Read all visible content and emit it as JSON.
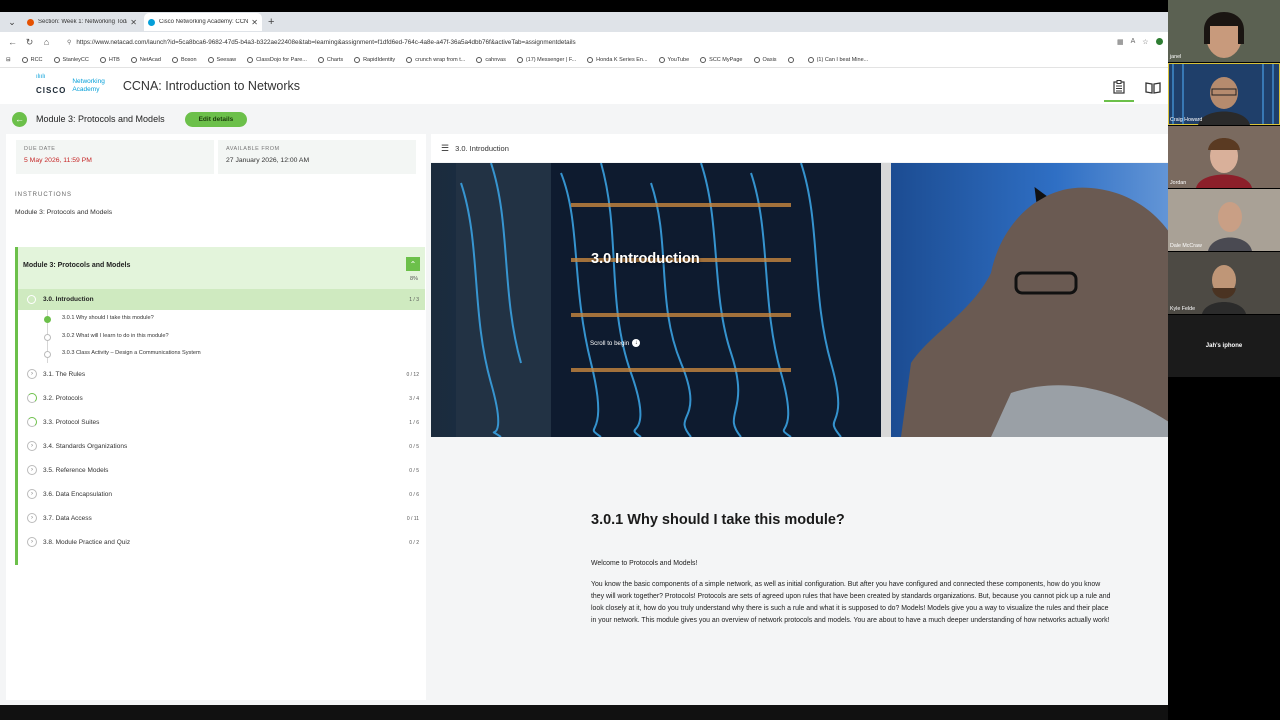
{
  "browser": {
    "tabs": [
      {
        "title": "Section: Week 1: Networking Toda",
        "favicon_color": "#e65100",
        "active": false
      },
      {
        "title": "Cisco Networking Academy: CCNA",
        "favicon_color": "#049fd9",
        "active": true
      }
    ],
    "url": "https://www.netacad.com/launch?id=5ca8bca6-9682-47d5-b4a3-b322ae22408e&tab=learning&assignment=f1dfd6ed-764c-4a8e-a47f-36a5a4dbb76f&activeTab=assignmentdetails",
    "bookmarks": [
      "RCC",
      "StanleyCC",
      "HTB",
      "NetAcad",
      "Boson",
      "Seesaw",
      "ClassDojo for Pare...",
      "Charts",
      "RapidIdentity",
      "crunch wrap from t...",
      "cahnvas",
      "(17) Messenger | F...",
      "Honda K Series En...",
      "YouTube",
      "SCC MyPage",
      "Oasis",
      "",
      "(1) Can I beat Mine..."
    ]
  },
  "app": {
    "logo_line1": "CISCO",
    "logo_line2a": "Networking",
    "logo_line2b": "Academy",
    "course_title": "CCNA: Introduction to Networks",
    "accent_color": "#6cc04a"
  },
  "module_bar": {
    "title": "Module 3: Protocols and Models",
    "edit_label": "Edit details"
  },
  "left": {
    "due_label": "DUE DATE",
    "due_value": "5 May 2026, 11:59 PM",
    "available_label": "AVAILABLE FROM",
    "available_value": "27 January 2026, 12:00 AM",
    "instructions_label": "INSTRUCTIONS",
    "instructions_value": "Module 3: Protocols and Models",
    "module": {
      "title": "Module 3: Protocols and Models",
      "percent": "8%",
      "active_section": {
        "title": "3.0. Introduction",
        "count": "1 / 3"
      },
      "subitems": [
        {
          "title": "3.0.1 Why should I take this module?",
          "done": true
        },
        {
          "title": "3.0.2 What will I learn to do in this module?",
          "done": false
        },
        {
          "title": "3.0.3 Class Activity – Design a Communications System",
          "done": false
        }
      ],
      "sections": [
        {
          "title": "3.1. The Rules",
          "count": "0 / 12",
          "partial": false
        },
        {
          "title": "3.2. Protocols",
          "count": "3 / 4",
          "partial": true
        },
        {
          "title": "3.3. Protocol Suites",
          "count": "1 / 6",
          "partial": true
        },
        {
          "title": "3.4. Standards Organizations",
          "count": "0 / 5",
          "partial": false
        },
        {
          "title": "3.5. Reference Models",
          "count": "0 / 5",
          "partial": false
        },
        {
          "title": "3.6. Data Encapsulation",
          "count": "0 / 6",
          "partial": false
        },
        {
          "title": "3.7. Data Access",
          "count": "0 / 11",
          "partial": false
        },
        {
          "title": "3.8. Module Practice and Quiz",
          "count": "0 / 2",
          "partial": false
        }
      ]
    }
  },
  "right": {
    "breadcrumb": "3.0. Introduction",
    "hero_title": "3.0 Introduction",
    "scroll_label": "Scroll to begin",
    "heading": "3.0.1 Why should I take this module?",
    "welcome": "Welcome to Protocols and Models!",
    "paragraph": "You know the basic components of a simple network, as well as initial configuration. But after you have configured and connected these components, how do you know they will work together? Protocols! Protocols are sets of agreed upon rules that have been created by standards organizations. But, because you cannot pick up a rule and look closely at it, how do you truly understand why there is such a rule and what it is supposed to do? Models! Models give you a way to visualize the rules and their place in your network. This module gives you an overview of network protocols and models. You are about to have a much deeper understanding of how networks actually work!"
  },
  "video_call": {
    "participants": [
      "janel",
      "Craig Howard",
      "Jordan",
      "Dale McCraw",
      "Kyle Felde",
      "Jah's iphone"
    ]
  }
}
